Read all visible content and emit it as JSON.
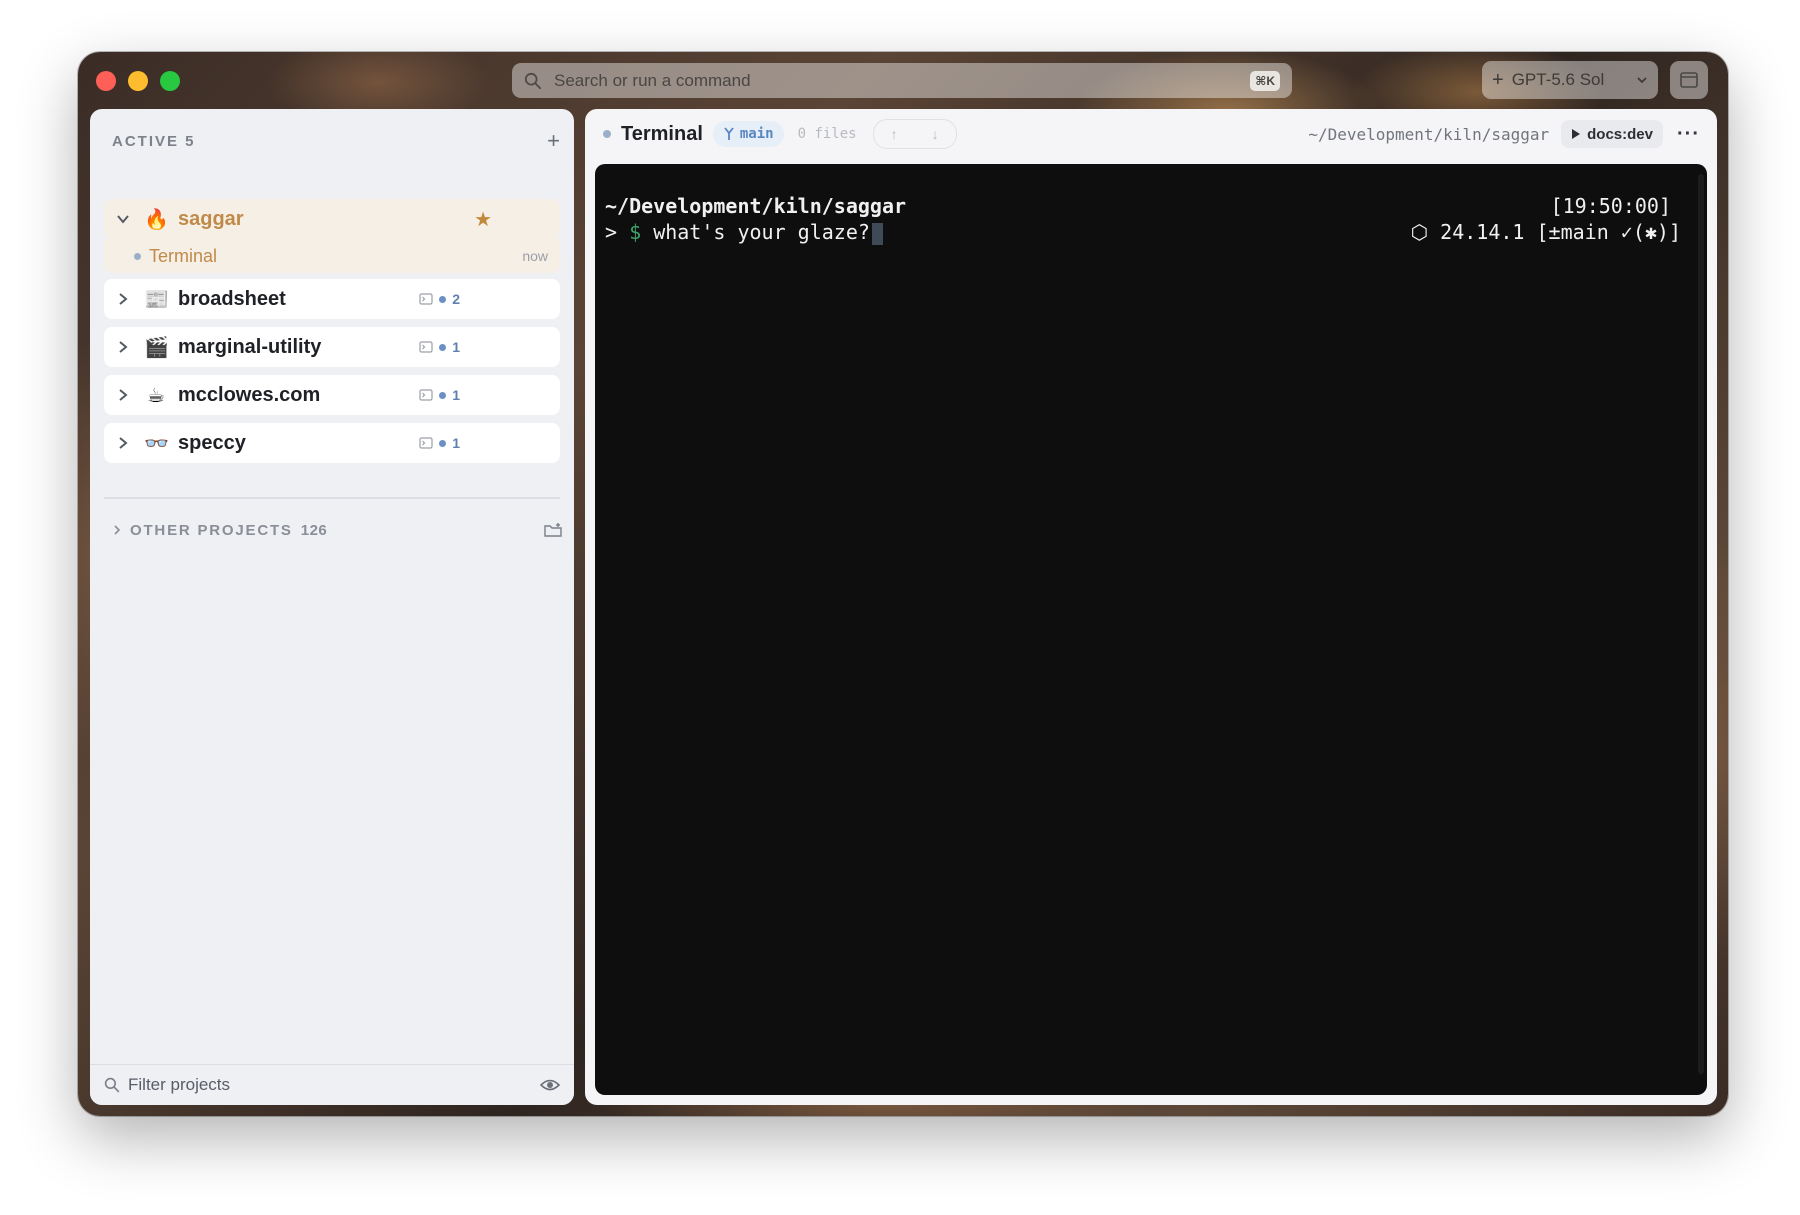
{
  "titlebar": {
    "search_placeholder": "Search or run a command",
    "search_shortcut": "⌘K",
    "model_label": "GPT-5.6 Sol"
  },
  "sidebar": {
    "section_title": "ACTIVE 5",
    "projects": [
      {
        "name": "saggar",
        "emoji": "🔥",
        "expanded": true,
        "starred": true,
        "sessions": [
          {
            "label": "Terminal",
            "time": "now"
          }
        ]
      },
      {
        "name": "broadsheet",
        "emoji": "📰",
        "count": "2"
      },
      {
        "name": "marginal-utility",
        "emoji": "🎬",
        "count": "1"
      },
      {
        "name": "mcclowes.com",
        "emoji": "☕",
        "count": "1"
      },
      {
        "name": "speccy",
        "emoji": "👓",
        "count": "1"
      }
    ],
    "other_label": "OTHER PROJECTS",
    "other_count": "126",
    "filter_placeholder": "Filter projects"
  },
  "main": {
    "title": "Terminal",
    "branch": "main",
    "files": "0 files",
    "path": "~/Development/kiln/saggar",
    "run_label": "docs:dev"
  },
  "terminal": {
    "cwd": "~/Development/kiln/saggar",
    "time": "[19:50:00]",
    "prompt_gt": ">",
    "prompt_dollar": "$",
    "command": "what's your glaze?",
    "right_status": "⬡ 24.14.1 [±main ✓(✱)]"
  },
  "colors": {
    "accent": "#c08a4a",
    "branch": "#5a86c0",
    "terminal_bg": "#0e0e0e",
    "prompt_green": "#3ea36a"
  }
}
